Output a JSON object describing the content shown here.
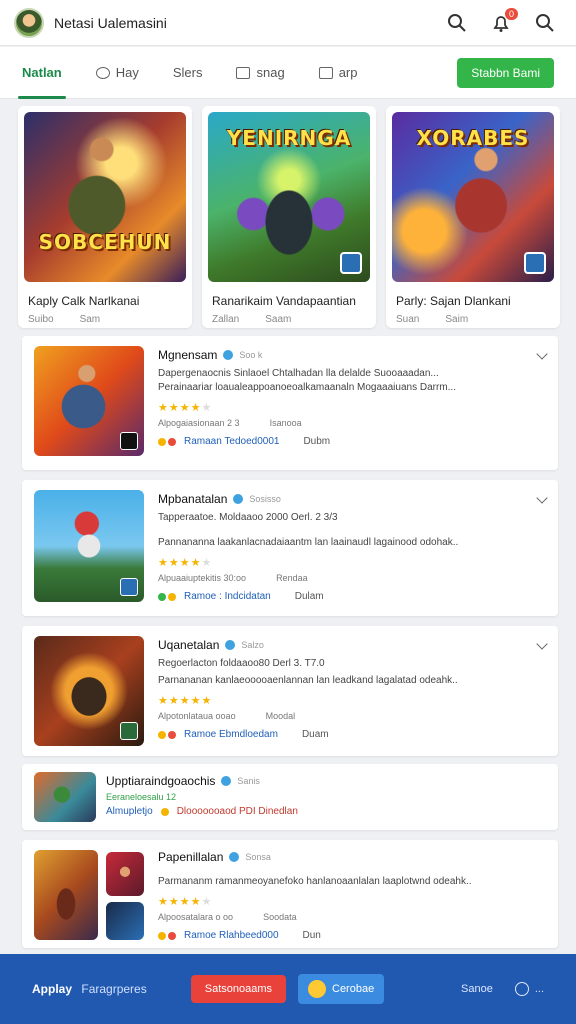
{
  "header": {
    "title": "Netasi Ualemasini",
    "notif_count": "0"
  },
  "tabs": [
    {
      "label": "Natlan"
    },
    {
      "label": "Hay"
    },
    {
      "label": "Slers"
    },
    {
      "label": "snag"
    },
    {
      "label": "arp"
    }
  ],
  "header_action": "Stabbn Bami",
  "featured": [
    {
      "img_text": "SOBCEHUN",
      "title": "Kaply Calk Narlkanai",
      "meta_a": "Suibo",
      "meta_b": "Sam"
    },
    {
      "img_text": "YENIRNGA",
      "title": "Ranarikaim Vandapaantian",
      "meta_a": "Zallan",
      "meta_b": "Saam"
    },
    {
      "img_text": "XORABES",
      "title": "Parly: Sajan Dlankani",
      "meta_a": "Suan",
      "meta_b": "Saim"
    }
  ],
  "list": [
    {
      "name": "Mgnensam",
      "sub": "Soo k",
      "desc1": "Dapergenaocnis Sinlaoel Chtalhadan lla delalde Suooaaadan...",
      "desc2": "Perainaariar loaualeappoanoeoalkamaanaln Mogaaaiuans Darrm...",
      "stars": 4,
      "row_a": "Alpogaiasionaan 2 3",
      "row_b": "Isanooa",
      "link": "Ramaan Tedoed0001",
      "act": "Dubm"
    },
    {
      "name": "Mpbanatalan",
      "sub": "Sosisso",
      "desc1": "Tapperaatoe. Moldaaoo 2000 Oerl. 2 3/3",
      "desc2": "Pannananna laakanlacnadaiaantm lan laainaudl lagainood odohak..",
      "stars": 4,
      "row_a": "Alpuaaiuptekitis 30:oo",
      "row_b": "Rendaa",
      "link": "Ramoe : Indcidatan",
      "act": "Dulam"
    },
    {
      "name": "Uqanetalan",
      "sub": "Salzo",
      "desc1": "Regoerlacton foldaaoo80 Derl 3. T7.0",
      "desc2": "Parnananan kanlaeooooaenlannan lan leadkand lagalatad odeahk..",
      "stars": 5,
      "row_a": "Alpotonlataua ooao",
      "row_b": "Moodal",
      "link": "Ramoe Ebmdloedam",
      "act": "Duam"
    },
    {
      "name": "Upptiaraindgoaochis",
      "sub": "Sanis",
      "desc1": "",
      "desc2": "",
      "stars": 0,
      "row_a": "Eeraneloesalu 12",
      "row_b": "",
      "link": "Dlooooooaod PDI Dinedlan",
      "act": "",
      "link_prefix": "Almupletjo"
    },
    {
      "name": "Papenillalan",
      "sub": "Sonsa",
      "desc1": "",
      "desc2": "Parmananm ramanmeoyanefoko hanlanoaanlalan laaplotwnd odeahk..",
      "stars": 4,
      "row_a": "Alpoosatalara o oo",
      "row_b": "Soodata",
      "link": "Ramoe Rlahbeed000",
      "act": "Dun"
    }
  ],
  "bottom": {
    "left_bold": "Applay",
    "left_light": "Faragrperes",
    "btn_red": "Satsonoaams",
    "btn_blue": "Cerobae",
    "right_text": "Sanoe",
    "more": "..."
  }
}
